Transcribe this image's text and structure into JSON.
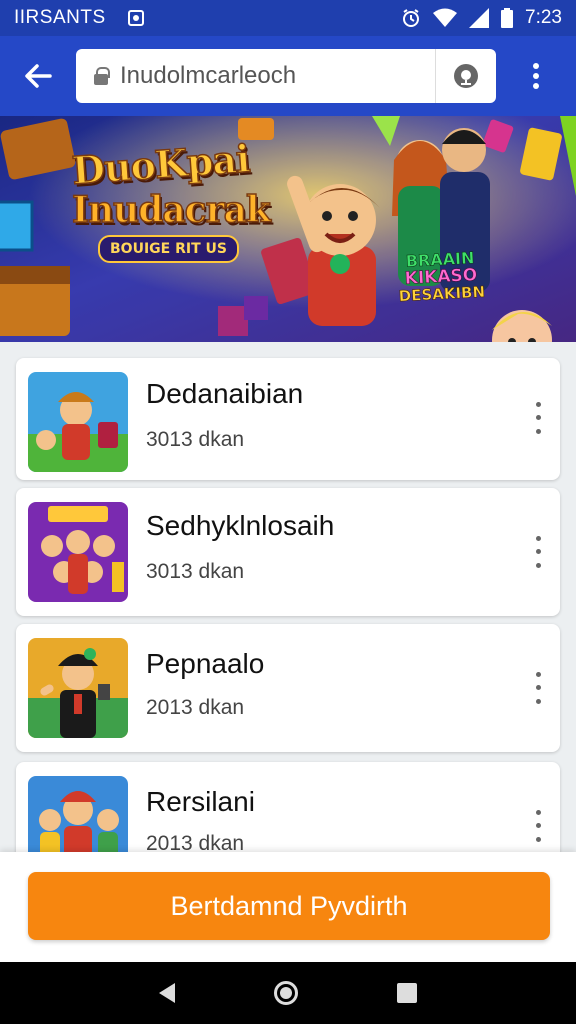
{
  "status_bar": {
    "carrier": "IIRSANTS",
    "time": "7:23"
  },
  "app_bar": {
    "back_icon": "arrow-left-icon",
    "search": {
      "value": "Inudolmcarleoch",
      "icon": "lock-icon",
      "voice_icon": "voice-search-icon"
    },
    "menu_icon": "more-vert-icon"
  },
  "banner": {
    "title_line1": "DuoKpai",
    "title_line2": "Inudacrak",
    "ribbon": "BOUIGE RIT US",
    "badge_line1": "BRAAIN",
    "badge_line2": "KIKASO",
    "badge_line3": "DESAKIBN"
  },
  "list": {
    "items": [
      {
        "title": "Dedanaibian",
        "subtitle": "3013 dkan"
      },
      {
        "title": "Sedhyklnlosaih",
        "subtitle": "3013 dkan"
      },
      {
        "title": "Pepnaalo",
        "subtitle": "2013 dkan"
      },
      {
        "title": "Rersilani",
        "subtitle": "2013 dkan"
      }
    ]
  },
  "cta": {
    "label": "Bertdamnd Pyvdirth"
  },
  "colors": {
    "app_bar": "#2548c7",
    "status_bar": "#1f3fae",
    "cta": "#f7860f"
  }
}
